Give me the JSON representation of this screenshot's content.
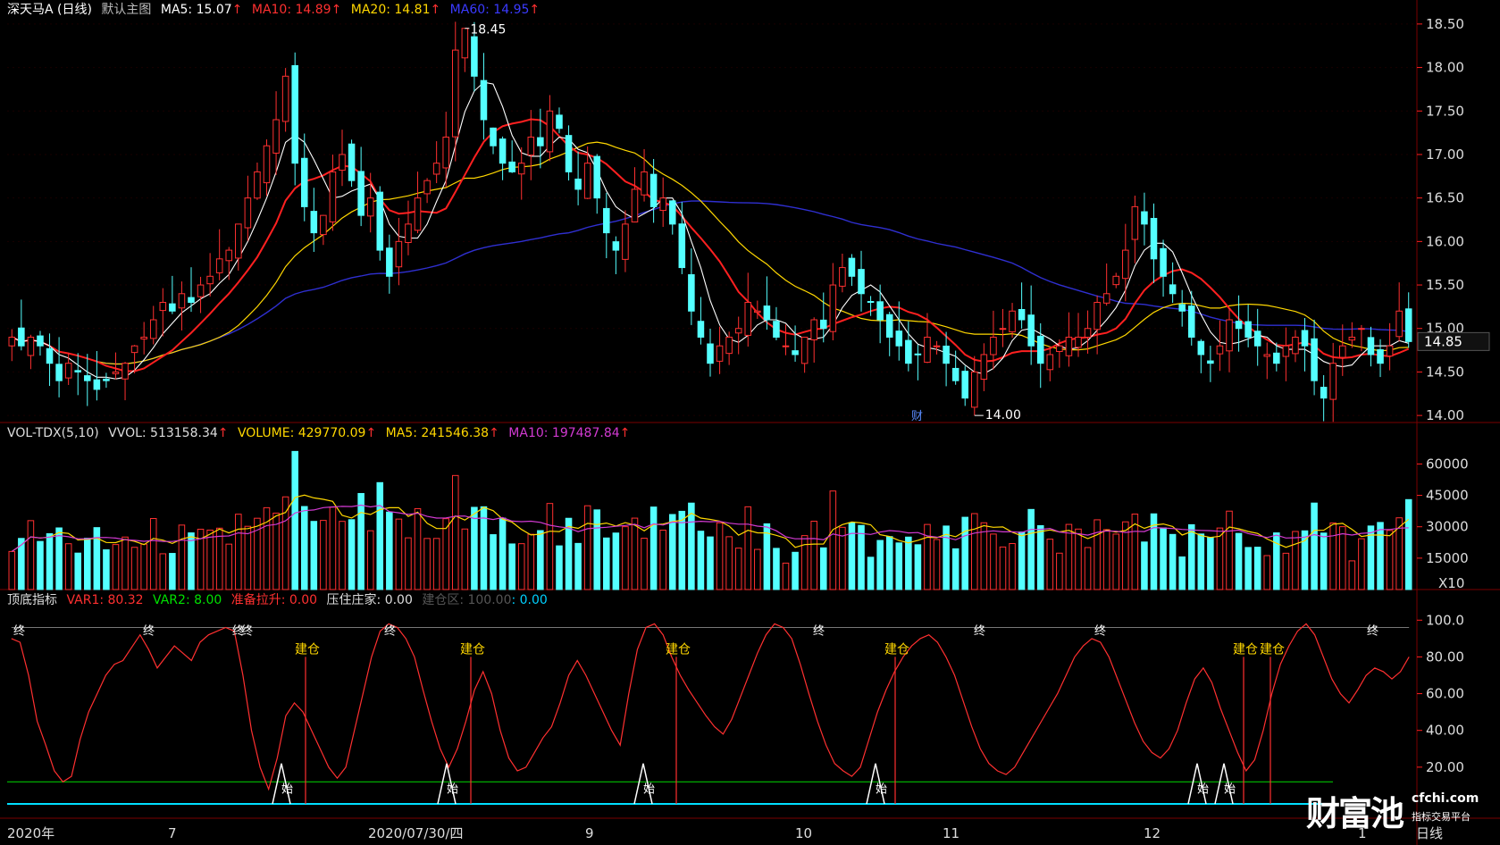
{
  "colors": {
    "bg": "#000000",
    "up": "#ff3030",
    "down": "#54ffff",
    "ma5": "#ffffff",
    "ma10": "#ff2020",
    "ma20": "#ffd700",
    "ma60": "#2f2fd0",
    "vol_ma5": "#ffd700",
    "vol_ma10": "#d23ad2",
    "grid": "#3a0000",
    "axis": "#ff2020",
    "green_line": "#00c000",
    "cyan_line": "#00e0ff"
  },
  "main": {
    "title": "深天马A (日线)",
    "subtitle": "默认主图",
    "ma5_label": "MA5: 15.07",
    "ma10_label": "MA10: 14.89",
    "ma20_label": "MA20: 14.81",
    "ma60_label": "MA60: 14.95",
    "arrow": "↑",
    "max_label": "18.45",
    "min_label": "14.00",
    "current_price": "14.85",
    "marker": "财",
    "y_ticks": [
      "18.50",
      "18.00",
      "17.50",
      "17.00",
      "16.50",
      "16.00",
      "15.50",
      "15.00",
      "14.50",
      "14.00"
    ]
  },
  "volume": {
    "title": "VOL-TDX(5,10)",
    "vvol_label": "VVOL: 513158.34",
    "volume_label": "VOLUME: 429770.09",
    "ma5_label": "MA5: 241546.38",
    "ma10_label": "MA10: 197487.84",
    "arrow": "↑",
    "y_ticks": [
      "60000",
      "45000",
      "30000",
      "15000"
    ],
    "unit": "X10"
  },
  "indicator": {
    "title": "顶底指标",
    "var1_label": "VAR1: 80.32",
    "var2_label": "VAR2: 8.00",
    "pull_label": "准备拉升: 0.00",
    "press_label": "压住庄家: 0.00",
    "build_zone_label": "建仓区: 100.00",
    "build_zone_value": ": 0.00",
    "arrow": "↑",
    "y_ticks": [
      "100.0",
      "80.00",
      "60.00",
      "40.00",
      "20.00"
    ],
    "end_text": "终",
    "start_text": "始",
    "build_text": "建仓"
  },
  "xaxis": {
    "labels": [
      "2020年",
      "7",
      "2020/07/30/四",
      "9",
      "10",
      "11",
      "12",
      "1",
      "日线"
    ]
  },
  "watermark": {
    "logo": "财富池",
    "domain": "cfchi.com",
    "sub": "指标交易平台"
  },
  "chart_data": [
    {
      "type": "candlestick",
      "title": "深天马A (日线)",
      "ylim": [
        13.95,
        18.55
      ],
      "series_ma": [
        {
          "name": "MA5",
          "last": 15.07
        },
        {
          "name": "MA10",
          "last": 14.89
        },
        {
          "name": "MA20",
          "last": 14.81
        },
        {
          "name": "MA60",
          "last": 14.95
        }
      ],
      "period_high": 18.45,
      "period_low": 14.0,
      "close": [
        14.9,
        14.8,
        14.9,
        14.8,
        14.6,
        14.4,
        14.6,
        14.5,
        14.4,
        14.3,
        14.4,
        14.5,
        14.6,
        14.8,
        14.9,
        15.1,
        15.3,
        15.2,
        15.4,
        15.3,
        15.5,
        15.6,
        15.8,
        15.9,
        16.2,
        16.5,
        16.8,
        17.1,
        17.4,
        17.9,
        16.9,
        16.4,
        16.1,
        16.3,
        16.8,
        17.0,
        16.7,
        16.3,
        16.5,
        15.9,
        15.6,
        16.0,
        16.2,
        16.5,
        16.7,
        16.9,
        17.2,
        18.2,
        18.45,
        17.9,
        17.4,
        17.1,
        16.9,
        16.8,
        16.9,
        17.2,
        17.1,
        17.5,
        17.3,
        16.8,
        16.6,
        16.9,
        16.5,
        16.1,
        15.9,
        16.2,
        16.6,
        16.8,
        16.4,
        16.5,
        16.2,
        15.7,
        15.2,
        14.9,
        14.6,
        14.8,
        14.9,
        15.0,
        15.3,
        15.2,
        15.1,
        14.9,
        14.8,
        14.7,
        14.9,
        15.1,
        15.0,
        15.5,
        15.7,
        15.6,
        15.4,
        15.3,
        15.1,
        14.9,
        14.8,
        14.6,
        14.7,
        14.9,
        14.8,
        14.6,
        14.4,
        14.2,
        14.5,
        14.7,
        14.9,
        15.0,
        15.2,
        15.1,
        14.8,
        14.6,
        14.7,
        14.8,
        14.9,
        14.9,
        15.0,
        15.3,
        15.4,
        15.6,
        15.9,
        16.4,
        16.2,
        15.8,
        15.6,
        15.4,
        15.2,
        14.9,
        14.7,
        14.6,
        14.8,
        15.1,
        15.0,
        14.9,
        14.8,
        14.7,
        14.6,
        14.8,
        14.9,
        14.8,
        14.4,
        14.2,
        14.6,
        14.8,
        14.9,
        15.0,
        14.7,
        14.6,
        14.8,
        15.2,
        14.85
      ],
      "ma60_last": 14.95
    },
    {
      "type": "bar",
      "title": "VOL-TDX(5,10)",
      "ylim": [
        0,
        70000
      ],
      "unit": "X10",
      "last_volume": 42977.009,
      "ma5_last": 24154.638,
      "ma10_last": 19748.784
    },
    {
      "type": "line",
      "title": "顶底指标",
      "ylim": [
        0,
        105
      ],
      "series": [
        {
          "name": "VAR1",
          "last": 80.32
        },
        {
          "name": "VAR2",
          "last": 8.0
        }
      ],
      "var1": [
        90,
        88,
        70,
        45,
        32,
        18,
        12,
        15,
        35,
        50,
        60,
        70,
        76,
        78,
        85,
        92,
        84,
        74,
        80,
        86,
        82,
        78,
        88,
        92,
        94,
        96,
        94,
        70,
        40,
        20,
        8,
        25,
        48,
        55,
        50,
        40,
        30,
        20,
        14,
        20,
        40,
        60,
        80,
        94,
        98,
        96,
        90,
        80,
        62,
        45,
        30,
        20,
        30,
        45,
        62,
        72,
        60,
        40,
        25,
        18,
        20,
        28,
        36,
        42,
        55,
        70,
        78,
        70,
        60,
        50,
        40,
        32,
        60,
        84,
        96,
        98,
        92,
        80,
        70,
        62,
        55,
        48,
        42,
        38,
        46,
        58,
        70,
        82,
        92,
        98,
        96,
        90,
        76,
        60,
        45,
        32,
        22,
        18,
        15,
        20,
        35,
        50,
        62,
        72,
        80,
        86,
        90,
        92,
        88,
        80,
        70,
        56,
        42,
        30,
        22,
        18,
        16,
        20,
        28,
        36,
        44,
        52,
        60,
        70,
        80,
        86,
        90,
        88,
        80,
        68,
        56,
        44,
        34,
        28,
        25,
        30,
        40,
        55,
        68,
        74,
        66,
        52,
        40,
        28,
        18,
        24,
        40,
        60,
        76,
        86,
        94,
        98,
        92,
        80,
        68,
        60,
        55,
        62,
        70,
        74,
        72,
        68,
        72,
        80
      ]
    }
  ]
}
